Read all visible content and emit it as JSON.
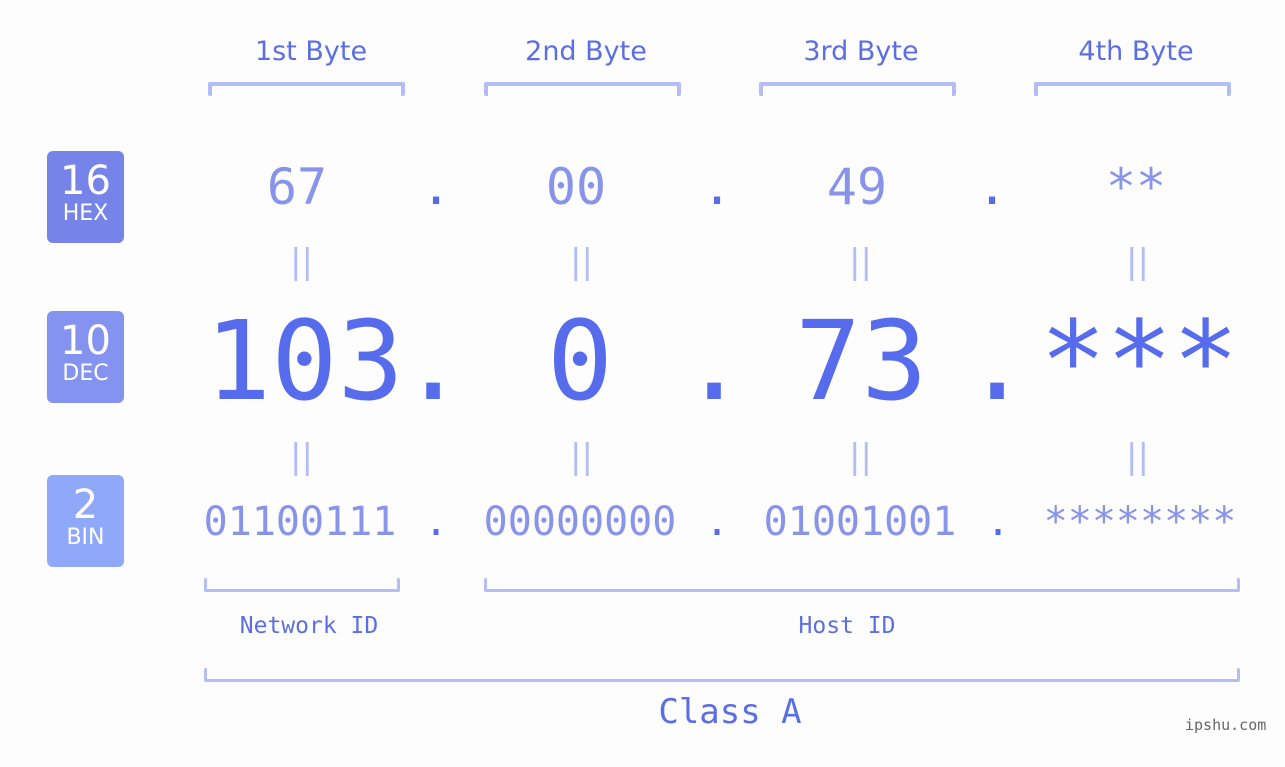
{
  "byte_headers": [
    "1st Byte",
    "2nd Byte",
    "3rd Byte",
    "4th Byte"
  ],
  "badges": {
    "hex": {
      "num": "16",
      "label": "HEX",
      "color": "#7684ea"
    },
    "dec": {
      "num": "10",
      "label": "DEC",
      "color": "#8593f0"
    },
    "bin": {
      "num": "2",
      "label": "BIN",
      "color": "#8fa8f9"
    }
  },
  "hex_values": [
    "67",
    "00",
    "49",
    "**"
  ],
  "dec_values": [
    "103",
    "0",
    "73",
    "***"
  ],
  "bin_values": [
    "01100111",
    "00000000",
    "01001001",
    "********"
  ],
  "separator": ".",
  "equals": "||",
  "network_id_label": "Network ID",
  "host_id_label": "Host ID",
  "class_label": "Class A",
  "watermark": "ipshu.com",
  "colors": {
    "accent": "#566ced",
    "light_text": "#8893ea",
    "bracket": "#b3bdf6",
    "background": "#fcfdfc"
  }
}
